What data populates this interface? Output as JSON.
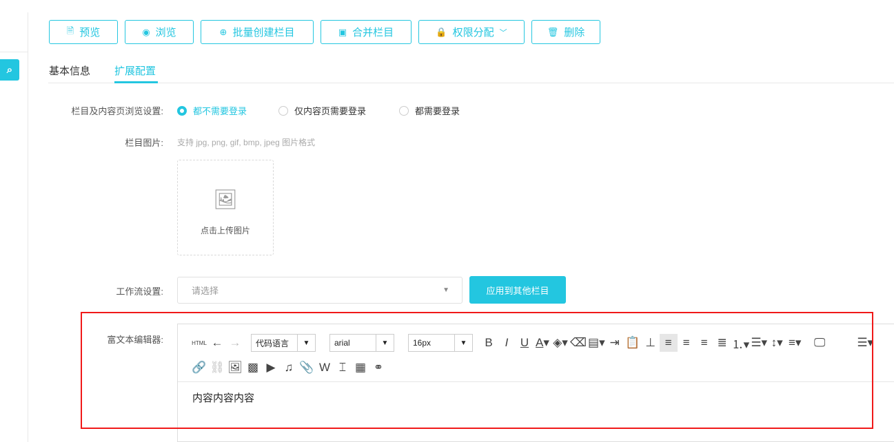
{
  "toolbar": {
    "buttons": [
      {
        "label": "预览",
        "icon": "file-search-icon",
        "glyph": "🗎"
      },
      {
        "label": "浏览",
        "icon": "eye-icon",
        "glyph": "◉"
      },
      {
        "label": "批量创建栏目",
        "icon": "add-batch-icon",
        "glyph": "⊕"
      },
      {
        "label": "合并栏目",
        "icon": "merge-icon",
        "glyph": "▣"
      },
      {
        "label": "权限分配",
        "icon": "lock-icon",
        "glyph": "🔒"
      },
      {
        "label": "删除",
        "icon": "trash-icon",
        "glyph": "🗑"
      }
    ]
  },
  "tabs": [
    {
      "label": "基本信息"
    },
    {
      "label": "扩展配置"
    }
  ],
  "form": {
    "browse_label": "栏目及内容页浏览设置:",
    "browse_options": [
      "都不需要登录",
      "仅内容页需要登录",
      "都需要登录"
    ],
    "browse_selected": 0,
    "image_label": "栏目图片:",
    "image_hint": "支持 jpg, png, gif, bmp, jpeg 图片格式",
    "upload_text": "点击上传图片",
    "workflow_label": "工作流设置:",
    "workflow_placeholder": "请选择",
    "apply_label": "应用到其他栏目",
    "editor_label": "富文本编辑器:"
  },
  "editor": {
    "html_label": "HTML",
    "code_lang": "代码语言",
    "font": "arial",
    "size": "16px",
    "content": "内容内容内容"
  },
  "accent": "#23c6e0"
}
